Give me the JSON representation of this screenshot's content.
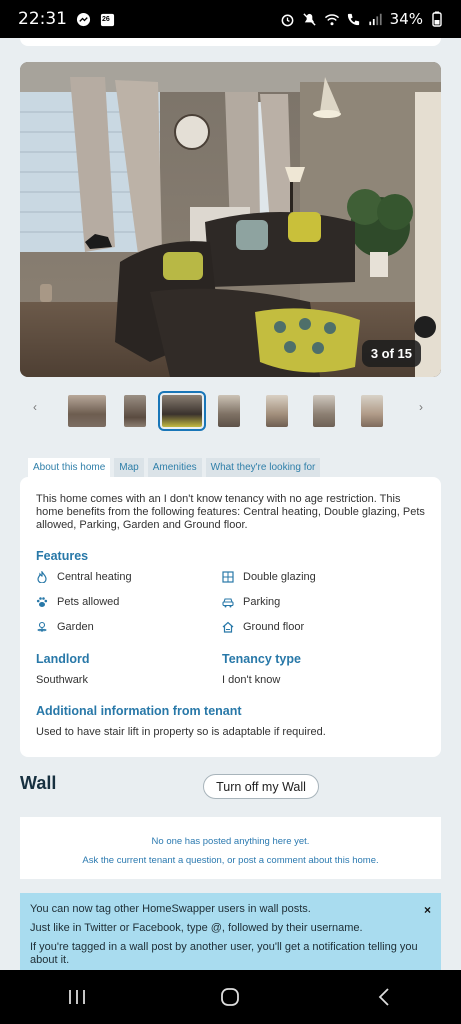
{
  "status_bar": {
    "time": "22:31",
    "calendar_badge": "26",
    "battery": "34%"
  },
  "gallery": {
    "counter": "3 of 15",
    "prev_arrow": "‹",
    "next_arrow": "›"
  },
  "tabs": [
    "About this home",
    "Map",
    "Amenities",
    "What they're looking for"
  ],
  "about": {
    "description": "This home comes with an I don't know tenancy with no age restriction. This home benefits from the following features: Central heating, Double glazing, Pets allowed, Parking, Garden and Ground floor.",
    "features_title": "Features",
    "features": [
      {
        "label": "Central heating",
        "icon": "flame-icon"
      },
      {
        "label": "Double glazing",
        "icon": "window-icon"
      },
      {
        "label": "Pets allowed",
        "icon": "paw-icon"
      },
      {
        "label": "Parking",
        "icon": "car-icon"
      },
      {
        "label": "Garden",
        "icon": "flower-icon"
      },
      {
        "label": "Ground floor",
        "icon": "house-icon"
      }
    ],
    "landlord_title": "Landlord",
    "landlord_value": "Southwark",
    "tenancy_title": "Tenancy type",
    "tenancy_value": "I don't know",
    "additional_title": "Additional information from tenant",
    "additional_text": "Used to have stair lift in property so is adaptable if required."
  },
  "wall": {
    "title": "Wall",
    "toggle_label": "Turn off my Wall",
    "empty_message": "No one has posted anything here yet.",
    "ask_message": "Ask the current tenant a question, or post a comment about this home."
  },
  "notice": {
    "line1": "You can now tag other HomeSwapper users in wall posts.",
    "line2": "Just like in Twitter or Facebook, type @, followed by their username.",
    "line3": "If you're tagged in a wall post by another user, you'll get a notification telling you about it.",
    "close": "×"
  },
  "colors": {
    "accent": "#2878a8",
    "notice_bg": "#a9dcef",
    "page_bg": "#e9eef1"
  }
}
